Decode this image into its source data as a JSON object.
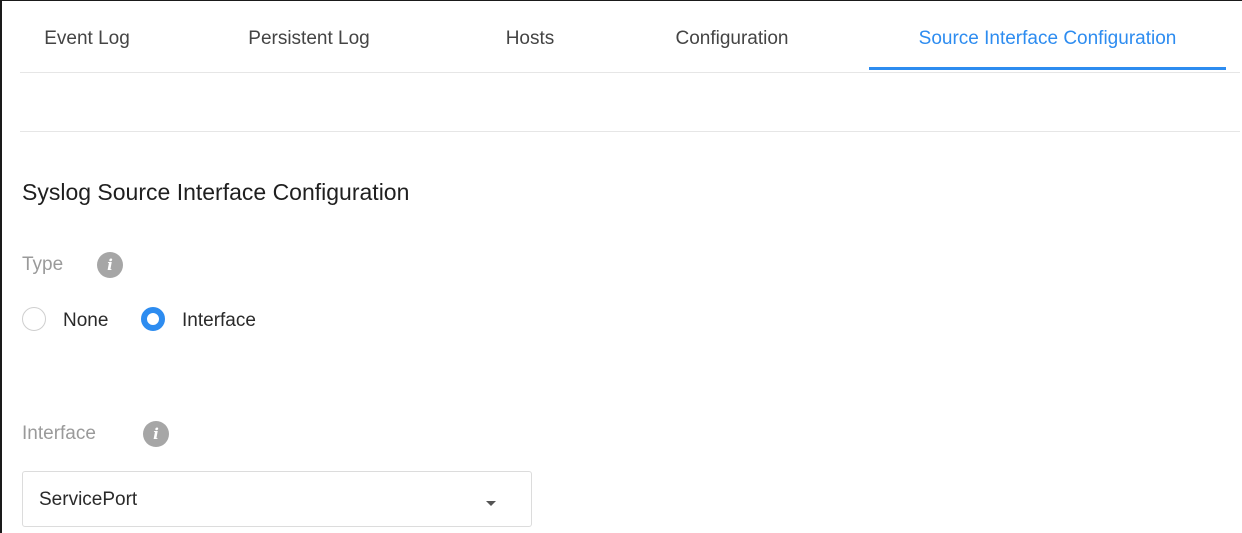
{
  "tabs": [
    {
      "label": "Event Log",
      "active": false
    },
    {
      "label": "Persistent Log",
      "active": false
    },
    {
      "label": "Hosts",
      "active": false
    },
    {
      "label": "Configuration",
      "active": false
    },
    {
      "label": "Source Interface Configuration",
      "active": true
    }
  ],
  "section": {
    "title": "Syslog Source Interface Configuration"
  },
  "type_field": {
    "label": "Type",
    "info_glyph": "i",
    "options": [
      {
        "label": "None",
        "selected": false
      },
      {
        "label": "Interface",
        "selected": true
      }
    ]
  },
  "interface_field": {
    "label": "Interface",
    "info_glyph": "i",
    "selected_value": "ServicePort"
  },
  "colors": {
    "accent": "#2d8cf0",
    "label_gray": "#9a9a9a",
    "info_icon_gray": "#a6a6a6"
  },
  "icons": [
    "info-icon",
    "radio-unselected",
    "radio-selected",
    "caret-down-icon"
  ]
}
